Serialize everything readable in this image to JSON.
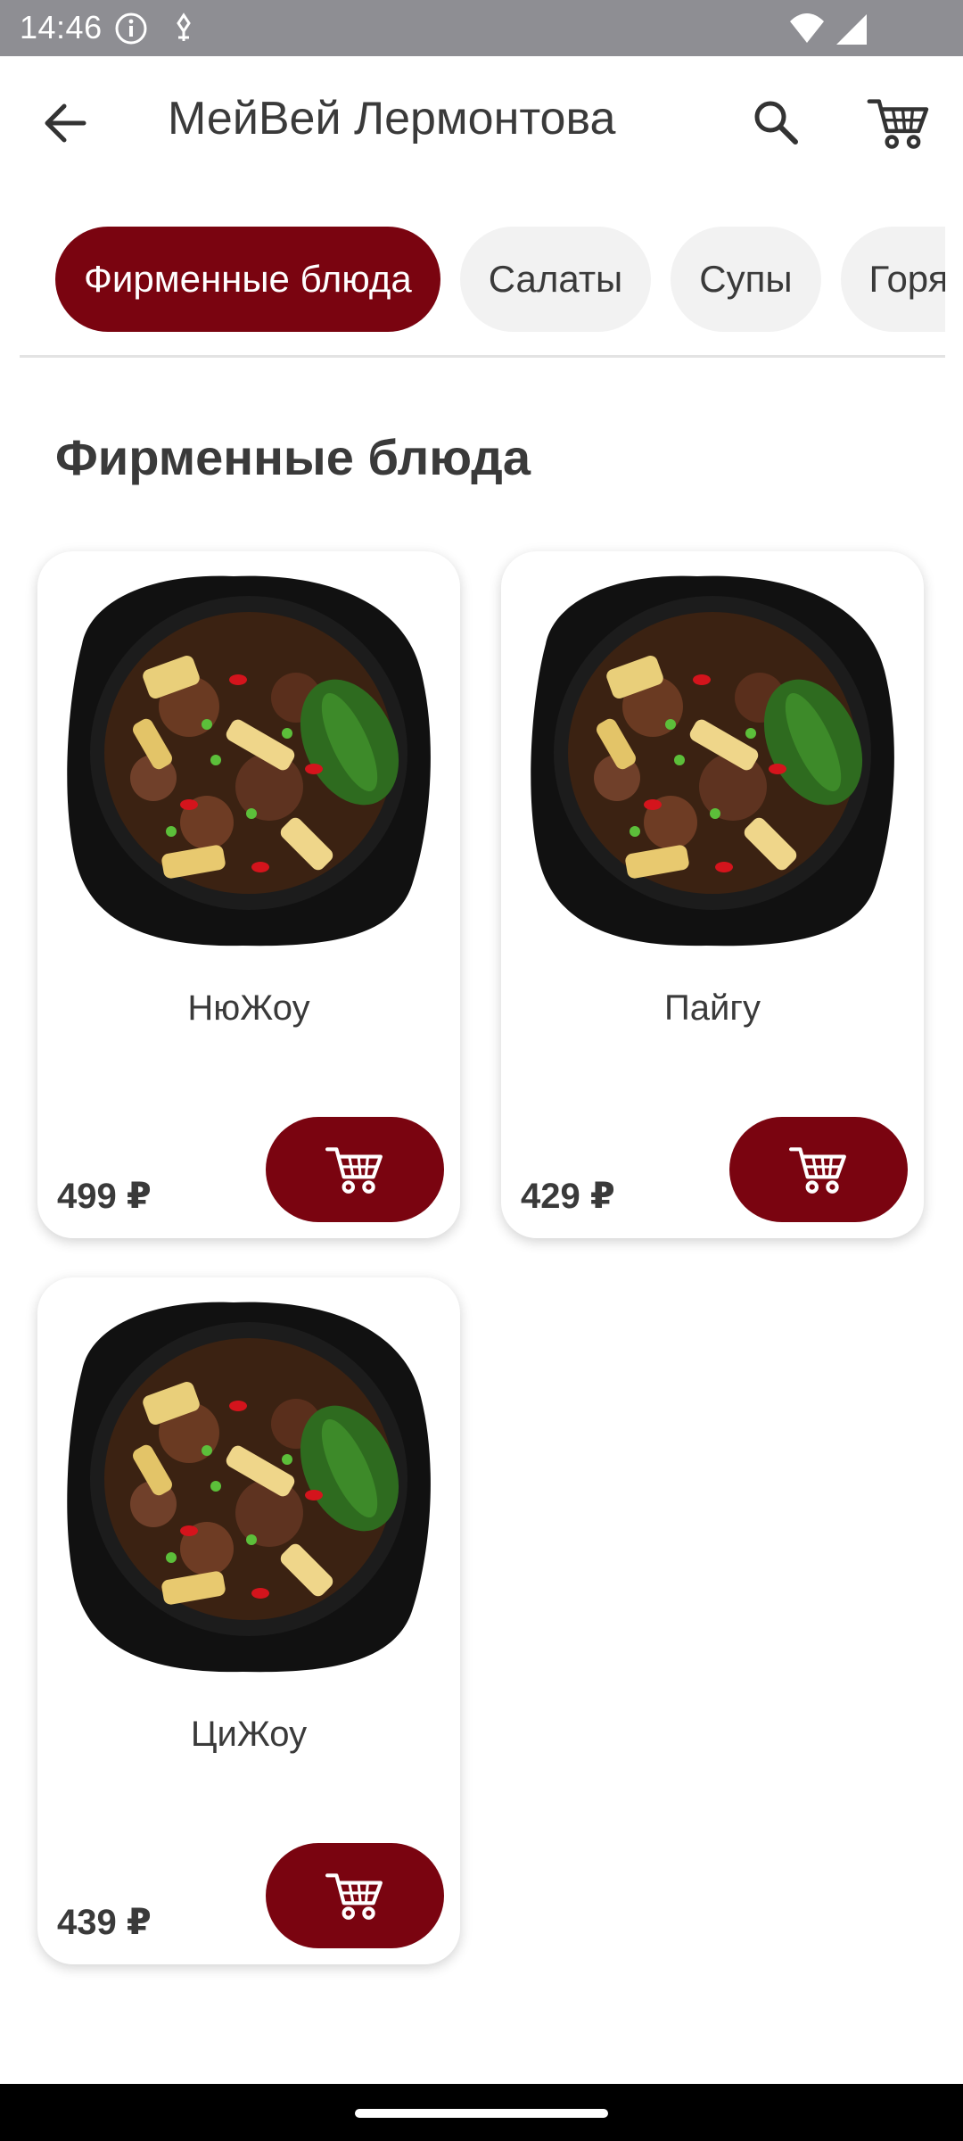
{
  "status_bar": {
    "time": "14:46",
    "icons": [
      "info-icon",
      "usb-debug-icon",
      "wifi-icon",
      "signal-icon"
    ]
  },
  "app_bar": {
    "title": "МейВей Лермонтова",
    "back_icon": "arrow-back-icon",
    "search_icon": "search-icon",
    "cart_icon": "cart-icon"
  },
  "tabs": [
    {
      "label": "Фирменные блюда",
      "active": true
    },
    {
      "label": "Салаты",
      "active": false
    },
    {
      "label": "Супы",
      "active": false
    },
    {
      "label": "Горячие блюда",
      "active": false
    }
  ],
  "section": {
    "title": "Фирменные блюда"
  },
  "products": [
    {
      "name": "НюЖоу",
      "price": "499 ₽"
    },
    {
      "name": "Пайгу",
      "price": "429 ₽"
    },
    {
      "name": "ЦиЖоу",
      "price": "439 ₽"
    }
  ],
  "colors": {
    "accent": "#7a0410",
    "tab_inactive": "#f2f2f2",
    "text": "#3a3a3a",
    "status_bar": "#8e8e93"
  }
}
